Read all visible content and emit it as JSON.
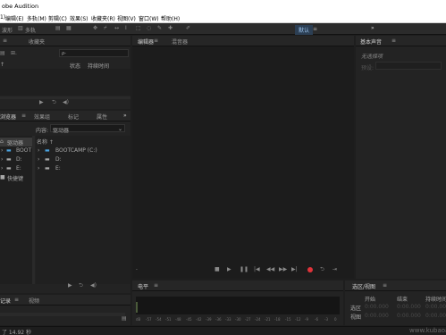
{
  "app": {
    "title": "obe Audition"
  },
  "menu": {
    "items": [
      "编辑(E)",
      "多轨(M)",
      "剪辑(C)",
      "效果(S)",
      "收藏夹(R)",
      "视图(V)",
      "窗口(W)",
      "帮助(H)"
    ],
    "first_fragment": "1)"
  },
  "toolbar": {
    "waveform_label": "波形",
    "multitrack_label": "多轨",
    "workspace_label": "默认",
    "workspace_menu": "≡",
    "overflow": "»"
  },
  "files_panel": {
    "tab_label": "≡",
    "favorites_tab": "收藏夹",
    "search_icon": "ρ-",
    "col_status": "状态",
    "col_duration": "持续时间"
  },
  "browser_panel": {
    "tab_browser": "浏览器",
    "tab_effects": "效果组",
    "tab_markers": "标记",
    "tab_properties": "属性",
    "overflow": "»",
    "content_label": "内容:",
    "content_value": "驱动器",
    "left_tree": {
      "section_drives": "驱动器",
      "items": [
        "BOOT",
        "D:",
        "E:"
      ],
      "section_shortcuts": "快捷键"
    },
    "right_header": "名称 ↑",
    "right_items": [
      "BOOTCAMP (C:)",
      "D:",
      "E:"
    ]
  },
  "editor_panel": {
    "tab_editor": "编辑器",
    "tab_mixer": "混音器",
    "bullet": "·"
  },
  "basic_sound": {
    "tab_label": "基本声音",
    "no_selection": "无选择项",
    "preset_label": "预设:"
  },
  "levels_panel": {
    "tab_label": "电平",
    "ticks": [
      "dB",
      "-57",
      "-54",
      "-51",
      "-48",
      "-45",
      "-42",
      "-39",
      "-36",
      "-33",
      "-30",
      "-27",
      "-24",
      "-21",
      "-18",
      "-15",
      "-12",
      "-9",
      "-6",
      "-3",
      "0"
    ]
  },
  "history_panel": {
    "tab_history": "记录",
    "tab_video": "视频"
  },
  "selection_panel": {
    "tab_label": "选区/视图",
    "col_start": "开始",
    "col_end": "结束",
    "col_duration": "持续时间",
    "row_selection": "选区",
    "row_view": "视图",
    "placeholder_time": "0:00.000"
  },
  "status": {
    "text": "了 14.92 秒",
    "watermark": "www.kubaoa"
  },
  "colors": {
    "accent": "#4a90d9",
    "record": "#e0333a",
    "drive_icon": "#4aa3e0"
  }
}
